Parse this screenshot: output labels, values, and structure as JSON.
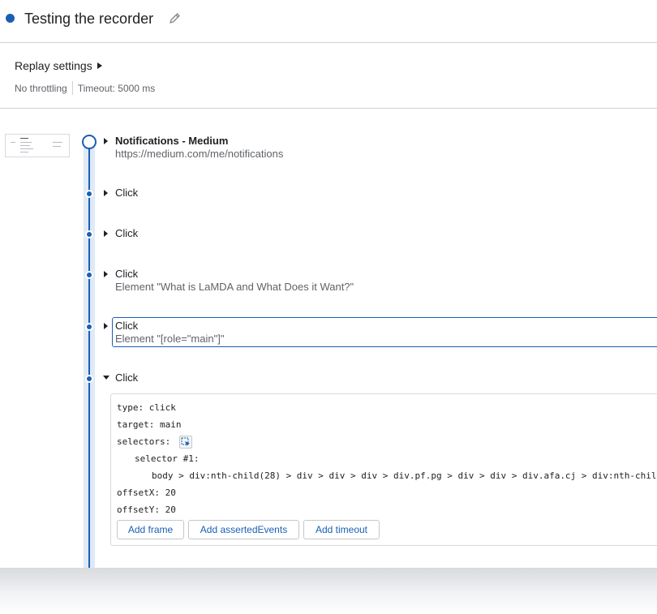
{
  "recording": {
    "title": "Testing the recorder"
  },
  "replay_settings": {
    "label": "Replay settings",
    "throttling": "No throttling",
    "timeout": "Timeout: 5000 ms"
  },
  "steps": [
    {
      "title": "Notifications - Medium",
      "subtitle": "https://medium.com/me/notifications"
    },
    {
      "title": "Click"
    },
    {
      "title": "Click"
    },
    {
      "title": "Click",
      "subtitle": "Element \"What is LaMDA and What Does it Want?\""
    },
    {
      "title": "Click",
      "subtitle": "Element \"[role=\"main\"]\""
    },
    {
      "title": "Click"
    }
  ],
  "step_details": {
    "type_line": "type: click",
    "target_line": "target: main",
    "selectors_line": "selectors:",
    "selector_label": "selector #1:",
    "selector_value": "body > div:nth-child(28) > div > div > div > div.pf.pg > div > div > div.afa.cj > div:nth-chil",
    "offset_x_line": "offsetX: 20",
    "offset_y_line": "offsetY: 20",
    "buttons": {
      "add_frame": "Add frame",
      "add_asserted_events": "Add assertedEvents",
      "add_timeout": "Add timeout"
    }
  },
  "colors": {
    "accent": "#1a5fb4",
    "timeline_track": "#dfe9f7",
    "text_secondary": "#5f6368"
  }
}
